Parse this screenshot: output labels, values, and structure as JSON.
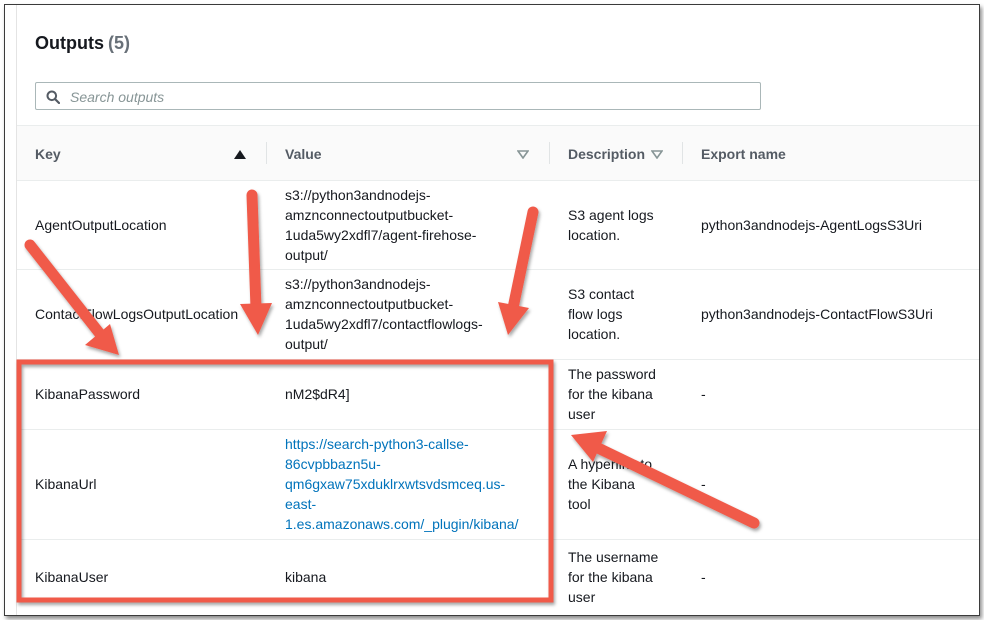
{
  "header": {
    "title": "Outputs",
    "count": "(5)"
  },
  "search": {
    "placeholder": "Search outputs",
    "value": ""
  },
  "columns": [
    "Key",
    "Value",
    "Description",
    "Export name"
  ],
  "rows": [
    {
      "key": "AgentOutputLocation",
      "value_lines": [
        "s3://python3andnodejs-",
        "amznconnectoutputbucket-",
        "1uda5wy2xdfl7/agent-firehose-",
        "output/"
      ],
      "desc_lines": [
        "S3 agent logs",
        "location."
      ],
      "export": "python3andnodejs-AgentLogsS3Uri"
    },
    {
      "key": "ContactFlowLogsOutputLocation",
      "value_lines": [
        "s3://python3andnodejs-",
        "amznconnectoutputbucket-",
        "1uda5wy2xdfl7/contactflowlogs-",
        "output/"
      ],
      "desc_lines": [
        "S3 contact",
        "flow logs",
        "location."
      ],
      "export": "python3andnodejs-ContactFlowS3Uri"
    },
    {
      "key": "KibanaPassword",
      "value_lines": [
        "nM2$dR4]"
      ],
      "desc_lines": [
        "The password",
        "for the kibana",
        "user"
      ],
      "export": "-"
    },
    {
      "key": "KibanaUrl",
      "value_lines": [
        "https://search-python3-callse-",
        "86cvpbbazn5u-",
        "qm6gxaw75xduklrxwtsvdsmceq.us-",
        "east-",
        "1.es.amazonaws.com/_plugin/kibana/"
      ],
      "desc_lines": [
        "A hyperlink to",
        "the Kibana",
        "tool"
      ],
      "export": "-"
    },
    {
      "key": "KibanaUser",
      "value_lines": [
        "kibana"
      ],
      "desc_lines": [
        "The username",
        "for the kibana",
        "user"
      ],
      "export": "-"
    }
  ],
  "colors": {
    "annotation": "#f05a4a",
    "link": "#0073bb"
  }
}
